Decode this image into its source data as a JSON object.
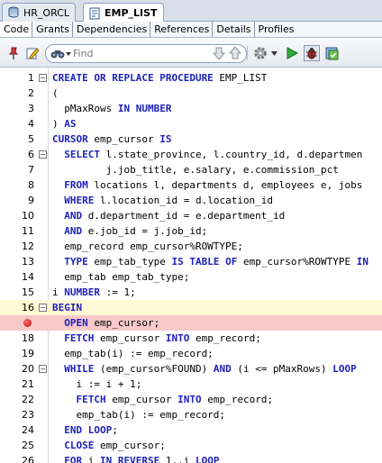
{
  "doc_tabs": [
    {
      "label": "HR_ORCL",
      "active": false
    },
    {
      "label": "EMP_LIST",
      "active": true
    }
  ],
  "sub_tabs": [
    "Code",
    "Grants",
    "Dependencies",
    "References",
    "Details",
    "Profiles"
  ],
  "toolbar": {
    "find_placeholder": "Find"
  },
  "editor": {
    "current_line": 16,
    "breakpoint_line": 17,
    "lines": [
      {
        "n": "1",
        "fold": "-",
        "tokens": [
          [
            "k",
            "CREATE OR REPLACE PROCEDURE"
          ],
          [
            "t",
            " EMP_LIST"
          ]
        ]
      },
      {
        "n": "2",
        "fold": "",
        "tokens": [
          [
            "t",
            "("
          ]
        ]
      },
      {
        "n": "3",
        "fold": "",
        "tokens": [
          [
            "t",
            "  pMaxRows "
          ],
          [
            "k",
            "IN NUMBER"
          ]
        ]
      },
      {
        "n": "4",
        "fold": "",
        "tokens": [
          [
            "t",
            ") "
          ],
          [
            "k",
            "AS"
          ]
        ]
      },
      {
        "n": "5",
        "fold": "",
        "tokens": [
          [
            "k",
            "CURSOR"
          ],
          [
            "t",
            " emp_cursor "
          ],
          [
            "k",
            "IS"
          ]
        ]
      },
      {
        "n": "6",
        "fold": "-",
        "tokens": [
          [
            "t",
            "  "
          ],
          [
            "k",
            "SELECT"
          ],
          [
            "t",
            " l.state_province, l.country_id, d.departmen"
          ]
        ]
      },
      {
        "n": "7",
        "fold": "",
        "tokens": [
          [
            "t",
            "         j.job_title, e.salary, e.commission_pct"
          ]
        ]
      },
      {
        "n": "8",
        "fold": "",
        "tokens": [
          [
            "t",
            "  "
          ],
          [
            "k",
            "FROM"
          ],
          [
            "t",
            " locations l, departments d, employees e, jobs"
          ]
        ]
      },
      {
        "n": "9",
        "fold": "",
        "tokens": [
          [
            "t",
            "  "
          ],
          [
            "k",
            "WHERE"
          ],
          [
            "t",
            " l.location_id = d.location_id"
          ]
        ]
      },
      {
        "n": "10",
        "fold": "",
        "tokens": [
          [
            "t",
            "  "
          ],
          [
            "k",
            "AND"
          ],
          [
            "t",
            " d.department_id = e.department_id"
          ]
        ]
      },
      {
        "n": "11",
        "fold": "",
        "tokens": [
          [
            "t",
            "  "
          ],
          [
            "k",
            "AND"
          ],
          [
            "t",
            " e.job_id = j.job_id;"
          ]
        ]
      },
      {
        "n": "12",
        "fold": "",
        "tokens": [
          [
            "t",
            "  emp_record emp_cursor%ROWTYPE;"
          ]
        ]
      },
      {
        "n": "13",
        "fold": "",
        "tokens": [
          [
            "t",
            "  "
          ],
          [
            "k",
            "TYPE"
          ],
          [
            "t",
            " emp_tab_type "
          ],
          [
            "k",
            "IS TABLE OF"
          ],
          [
            "t",
            " emp_cursor%ROWTYPE "
          ],
          [
            "k",
            "IN"
          ]
        ]
      },
      {
        "n": "14",
        "fold": "",
        "tokens": [
          [
            "t",
            "  emp_tab emp_tab_type;"
          ]
        ]
      },
      {
        "n": "15",
        "fold": "",
        "tokens": [
          [
            "t",
            "i "
          ],
          [
            "k",
            "NUMBER"
          ],
          [
            "t",
            " := 1;"
          ]
        ]
      },
      {
        "n": "16",
        "fold": "-",
        "tokens": [
          [
            "k",
            "BEGIN"
          ]
        ]
      },
      {
        "n": "",
        "fold": "",
        "tokens": [
          [
            "t",
            "  "
          ],
          [
            "k",
            "OPEN"
          ],
          [
            "t",
            " emp_cursor;"
          ]
        ]
      },
      {
        "n": "18",
        "fold": "",
        "tokens": [
          [
            "t",
            "  "
          ],
          [
            "k",
            "FETCH"
          ],
          [
            "t",
            " emp_cursor "
          ],
          [
            "k",
            "INTO"
          ],
          [
            "t",
            " emp_record;"
          ]
        ]
      },
      {
        "n": "19",
        "fold": "",
        "tokens": [
          [
            "t",
            "  emp_tab(i) := emp_record;"
          ]
        ]
      },
      {
        "n": "20",
        "fold": "-",
        "tokens": [
          [
            "t",
            "  "
          ],
          [
            "k",
            "WHILE"
          ],
          [
            "t",
            " (emp_cursor%FOUND) "
          ],
          [
            "k",
            "AND"
          ],
          [
            "t",
            " (i <= pMaxRows) "
          ],
          [
            "k",
            "LOOP"
          ]
        ]
      },
      {
        "n": "21",
        "fold": "",
        "tokens": [
          [
            "t",
            "    i := i + 1;"
          ]
        ]
      },
      {
        "n": "22",
        "fold": "",
        "tokens": [
          [
            "t",
            "    "
          ],
          [
            "k",
            "FETCH"
          ],
          [
            "t",
            " emp_cursor "
          ],
          [
            "k",
            "INTO"
          ],
          [
            "t",
            " emp_record;"
          ]
        ]
      },
      {
        "n": "23",
        "fold": "",
        "tokens": [
          [
            "t",
            "    emp_tab(i) := emp_record;"
          ]
        ]
      },
      {
        "n": "24",
        "fold": "",
        "tokens": [
          [
            "t",
            "  "
          ],
          [
            "k",
            "END LOOP"
          ],
          [
            "t",
            ";"
          ]
        ]
      },
      {
        "n": "25",
        "fold": "",
        "tokens": [
          [
            "t",
            "  "
          ],
          [
            "k",
            "CLOSE"
          ],
          [
            "t",
            " emp_cursor;"
          ]
        ]
      },
      {
        "n": "26",
        "fold": "",
        "tokens": [
          [
            "t",
            "  "
          ],
          [
            "k",
            "FOR"
          ],
          [
            "t",
            " i "
          ],
          [
            "k",
            "IN REVERSE"
          ],
          [
            "t",
            " 1..i "
          ],
          [
            "k",
            "LOOP"
          ]
        ]
      }
    ]
  },
  "colors": {
    "keyword": "#1e22b8",
    "current_line_bg": "#fff9d6",
    "breakpoint_line_bg": "#f7c9c9",
    "breakpoint_dot": "#c00000"
  },
  "icons": {
    "doc_tab_0": "database-connection-icon",
    "doc_tab_1": "procedure-icon",
    "toolbar": [
      "pin-icon",
      "edit-icon",
      "find-binoculars-icon",
      "find-next-icon",
      "find-previous-icon",
      "settings-gear-icon",
      "run-icon",
      "debug-icon",
      "compile-icon"
    ]
  }
}
